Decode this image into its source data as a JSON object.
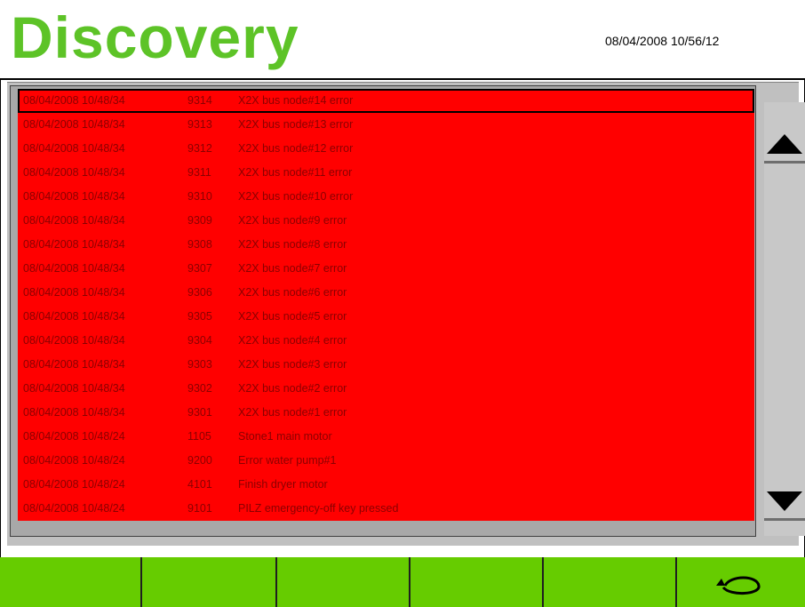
{
  "header": {
    "title": "Discovery",
    "datetime": "08/04/2008 10/56/12"
  },
  "colors": {
    "title_green": "#5dc327",
    "row_background": "#ff0000",
    "row_text": "#8a0000",
    "footer_green": "#66cc00",
    "panel_gray": "#c0c0c0"
  },
  "alarms": [
    {
      "date": "08/04/2008 10/48/34",
      "code": "9314",
      "message": "X2X bus node#14 error",
      "selected": true
    },
    {
      "date": "08/04/2008 10/48/34",
      "code": "9313",
      "message": "X2X bus node#13 error"
    },
    {
      "date": "08/04/2008 10/48/34",
      "code": "9312",
      "message": "X2X bus node#12 error"
    },
    {
      "date": "08/04/2008 10/48/34",
      "code": "9311",
      "message": "X2X bus node#11 error"
    },
    {
      "date": "08/04/2008 10/48/34",
      "code": "9310",
      "message": "X2X bus node#10 error"
    },
    {
      "date": "08/04/2008 10/48/34",
      "code": "9309",
      "message": "X2X bus node#9 error"
    },
    {
      "date": "08/04/2008 10/48/34",
      "code": "9308",
      "message": "X2X bus node#8 error"
    },
    {
      "date": "08/04/2008 10/48/34",
      "code": "9307",
      "message": "X2X bus node#7 error"
    },
    {
      "date": "08/04/2008 10/48/34",
      "code": "9306",
      "message": "X2X bus node#6 error"
    },
    {
      "date": "08/04/2008 10/48/34",
      "code": "9305",
      "message": "X2X bus node#5 error"
    },
    {
      "date": "08/04/2008 10/48/34",
      "code": "9304",
      "message": "X2X bus node#4 error"
    },
    {
      "date": "08/04/2008 10/48/34",
      "code": "9303",
      "message": "X2X bus node#3 error"
    },
    {
      "date": "08/04/2008 10/48/34",
      "code": "9302",
      "message": "X2X bus node#2 error"
    },
    {
      "date": "08/04/2008 10/48/34",
      "code": "9301",
      "message": "X2X bus node#1 error"
    },
    {
      "date": "08/04/2008 10/48/24",
      "code": "1105",
      "message": "Stone1 main motor"
    },
    {
      "date": "08/04/2008 10/48/24",
      "code": "9200",
      "message": "Error water pump#1"
    },
    {
      "date": "08/04/2008 10/48/24",
      "code": "4101",
      "message": "Finish dryer motor"
    },
    {
      "date": "08/04/2008 10/48/24",
      "code": "9101",
      "message": "PILZ emergency-off key pressed"
    }
  ],
  "scrollbar": {
    "up_icon": "triangle-up-icon",
    "down_icon": "triangle-down-icon"
  },
  "footer": {
    "buttons": [
      "",
      "",
      "",
      "",
      "",
      "return-icon"
    ]
  }
}
